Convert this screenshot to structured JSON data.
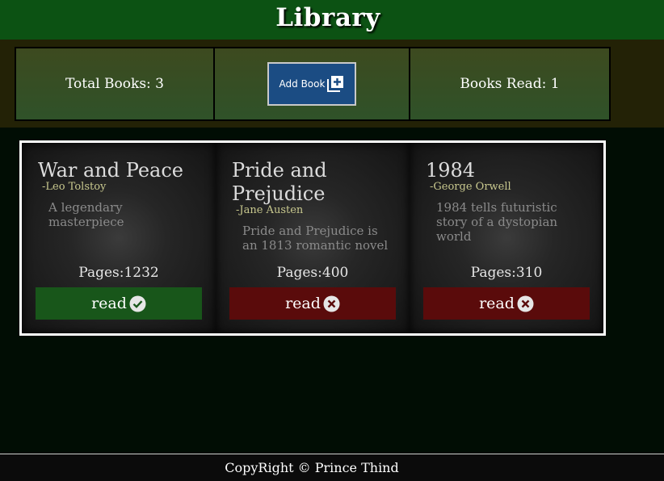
{
  "header": {
    "title": "Library"
  },
  "stats": {
    "total_books": "Total Books: 3",
    "add_book_label": "Add Book",
    "books_read": "Books Read: 1"
  },
  "books": [
    {
      "title": "War and Peace",
      "author": "-Leo Tolstoy",
      "description": "A legendary masterpiece",
      "pages": "Pages:1232",
      "read_label": "read",
      "read": true,
      "status_icon": "check-circle-icon"
    },
    {
      "title": "Pride and Prejudice",
      "author": "-Jane Austen",
      "description": "Pride and Prejudice is an 1813 romantic novel",
      "pages": "Pages:400",
      "read_label": "read",
      "read": false,
      "status_icon": "x-circle-icon"
    },
    {
      "title": "1984",
      "author": "-George Orwell",
      "description": "1984 tells futuristic story of a dystopian world",
      "pages": "Pages:310",
      "read_label": "read",
      "read": false,
      "status_icon": "x-circle-icon"
    }
  ],
  "footer": {
    "text": "CopyRight © Prince Thind"
  },
  "colors": {
    "header_bg": "#0c5213",
    "read_button": "#18561a",
    "unread_button": "#5a0b0b",
    "add_button": "#1b4c83"
  }
}
